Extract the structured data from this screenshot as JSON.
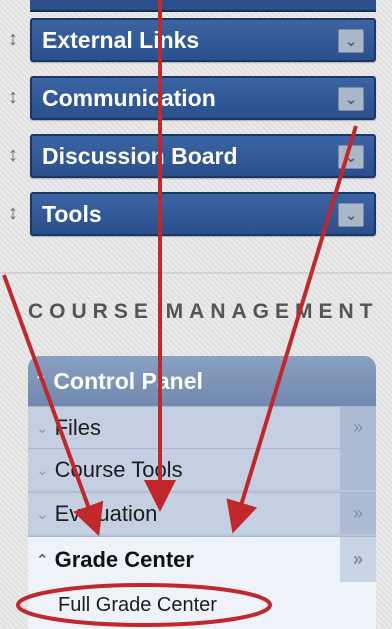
{
  "course_menu": {
    "items": [
      {
        "label": "External Links"
      },
      {
        "label": "Communication"
      },
      {
        "label": "Discussion Board"
      },
      {
        "label": "Tools"
      }
    ]
  },
  "course_management": {
    "heading": "COURSE MANAGEMENT",
    "control_panel": {
      "title": "Control Panel",
      "items": [
        {
          "label": "Files"
        },
        {
          "label": "Course Tools"
        },
        {
          "label": "Evaluation"
        },
        {
          "label": "Grade Center",
          "expanded": true
        }
      ],
      "sub_items": [
        {
          "label": "Full Grade Center"
        }
      ]
    }
  },
  "colors": {
    "menu_button": "#2f5797",
    "panel": "#b9c7dc",
    "annotation": "#c0282b"
  },
  "icons": {
    "menu_chevron": "double-chevron-down-icon",
    "drag_handle": "drag-handle-icon",
    "expand": "double-chevron-right-icon"
  }
}
